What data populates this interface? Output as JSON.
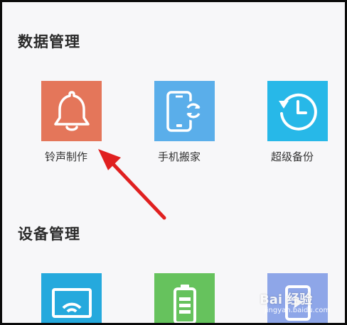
{
  "sections": {
    "data_management": {
      "title": "数据管理",
      "items": [
        {
          "label": "铃声制作",
          "icon": "bell-icon",
          "color": "#e4765a"
        },
        {
          "label": "手机搬家",
          "icon": "phone-transfer-icon",
          "color": "#5aaeea"
        },
        {
          "label": "超级备份",
          "icon": "backup-clock-icon",
          "color": "#27b8e8"
        }
      ]
    },
    "device_management": {
      "title": "设备管理",
      "items": [
        {
          "icon": "screen-cast-icon",
          "color": "#25a9dd"
        },
        {
          "icon": "battery-icon",
          "color": "#66c25d"
        },
        {
          "icon": "media-icon",
          "color": "#8ea6e8"
        }
      ]
    }
  },
  "annotation": {
    "arrow_color": "#e02020"
  },
  "watermark": {
    "text": "Bai 经验",
    "sub": "jingyan.baidu.com"
  }
}
